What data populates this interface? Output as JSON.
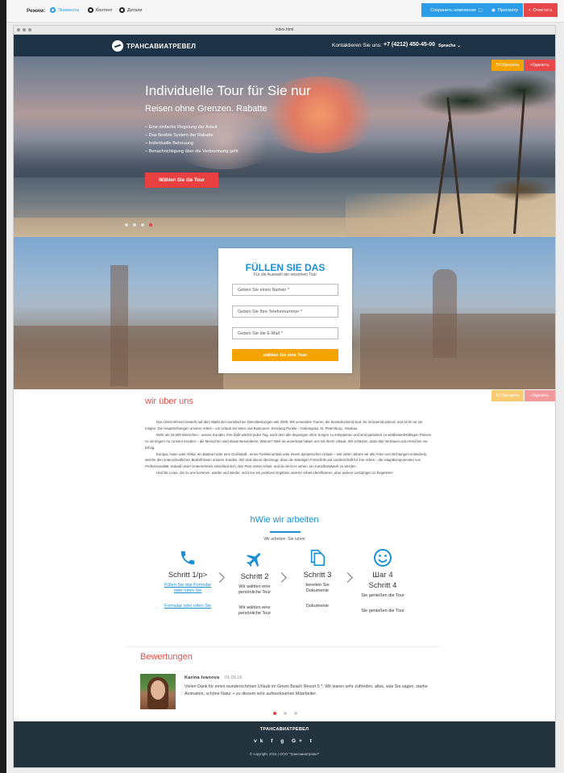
{
  "toolbar": {
    "mode_label": "Режим:",
    "modes": [
      {
        "label": "Элементы",
        "active": true
      },
      {
        "label": "Контент",
        "active": false
      },
      {
        "label": "Детали",
        "active": false
      }
    ],
    "save_label": "Сохранить изменения",
    "preview_label": "Просмотр",
    "clear_label": "Очистить",
    "save_color": "#2b9de8",
    "clear_color": "#e8474a"
  },
  "frame": {
    "title": "index.html"
  },
  "header": {
    "logo": "ТРАНСАВИАТРЕВЕЛ",
    "contact_label": "Kontaktieren Sie uns:",
    "phone": "+7 (4212) 450-45-00",
    "language": "Sprache"
  },
  "section_controls": {
    "reset": "Сбросить",
    "delete": "Удалить"
  },
  "hero": {
    "title": "Individuelle Tour für Sie nur",
    "subtitle": "Reisen ohne Grenzen. Rabatte",
    "features": [
      "– Eine einfache Regelung der Arbeit",
      "– Das flexible System der Rabatte",
      "– Individuelle Betreuung",
      "– Benachrichtigung über die Verbrennung geht"
    ],
    "button": "Wählen Sie die Tour",
    "slides": 4,
    "active_slide": 4
  },
  "form": {
    "title": "FÜLLEN SIE DAS",
    "subtitle": "Für die Auswahl der einzelnen Tour",
    "name_placeholder": "Geben Sie einen Namen *",
    "phone_placeholder": "Geben Sie Ihre Telefonnummer *",
    "email_placeholder": "Geben Sie die E-Mail *",
    "button": "wählen Sie eine Tour"
  },
  "about": {
    "title": "wir über uns",
    "paragraphs": [
      "Das Unternehmen besteht auf dem Markt der touristischen Dienstleistungen seit 2000. Wir versenden Touren, die beeindruckend sind. Es ist beeindruckend, und nicht nur sie mögen. Die Hauptrichtungen unserer Arbeit – ein Urlaub am Meer und Bustouren. Sendung Punkte – Kaliningrad, St. Petersburg , Moskau.",
      "Mehr als 15.000 Menschen - unsere Kunden. Ihre Zahl wächst jeden Tag, nach dem alle diejenigen ohne Sorgen zu entspannen und sind garantiert zu wettbewerbsfähigen Preisen zu verringern mi. Unsere Kunden – die Menschen sind etwas Besonderes. Warum? Weil sie anvertraut haben uns mit ihrem Urlaub. Wir schätzen, dass das Vertrauen und erreichen nur Erfolg.",
      "Europa, Asien oder Afrika, ein Badeort oder eine Großstadt , einen Familienurlaub oder einem dynamischen Urlaub – seit vielen Jahren wir alle Arten von Richtungen entwickeln, welche den unterschiedlichen Bedürfnissen unserer Kunden. Wir sind davon überzeugt, dass die ständigen Fortschritt und Leidenschaft für ihre Arbeit – die Hauptkomponenten von Professionalität. Sobald unser Unternehmen entschied sich, den Rest seiner Arbeit, und du wirst es sehen, ein Kunsthandwerk zu werden.",
      "Und die Leute, die zu uns kommen, wieder und wieder, nicht nur ein positives Ergebnis unserer Arbeit identifizieren, aber weitere Leistungen zu begeistern ."
    ]
  },
  "works": {
    "title": "hWie wir arbeiten",
    "subtitle": "Wir arbeiten. Sie ruhen",
    "steps": [
      {
        "icon": "phone-icon",
        "name": "Schritt 1/p>",
        "desc": "Füllen Sie das Formular oder rufen Sie",
        "desc2": "Formular oder rufen Sie"
      },
      {
        "icon": "plane-icon",
        "name": "Schritt 2",
        "desc": "Wir wählen eine persönliche Tour",
        "desc2": "Wir wählen eine persönliche Tour"
      },
      {
        "icon": "documents-icon",
        "name": "Schritt 3",
        "desc": "bereiten Sie Dokumente",
        "desc2": "Dokumente"
      },
      {
        "icon": "smiley-icon",
        "name": "Шаг 4",
        "name2": "Schritt 4",
        "desc": "Sie genießen die Tour",
        "desc2": "Sie genießen die Tour"
      }
    ],
    "accent": "#1a8fd6"
  },
  "reviews": {
    "title": "Bewertungen",
    "name": "Karina Ivanova",
    "date": "01.09.16",
    "text": "Vielen Dank für einen wunderschönen Urlaub im Green Beach Resort 5 *. Wir waren sehr zufrieden, alles, was Sie sagen, starke Animation, schöne Natur + zu diesem sehr aufmerksamen Mitarbeiter.",
    "dots": 3,
    "active_dot": 1
  },
  "footer": {
    "logo": "ТРАНСАВИАТРЕВЕЛ",
    "social": [
      "vk",
      "f",
      "g",
      "G+",
      "t"
    ],
    "copyright": "© copyright, 2016 | ООО \"Трансавиатревел\""
  }
}
